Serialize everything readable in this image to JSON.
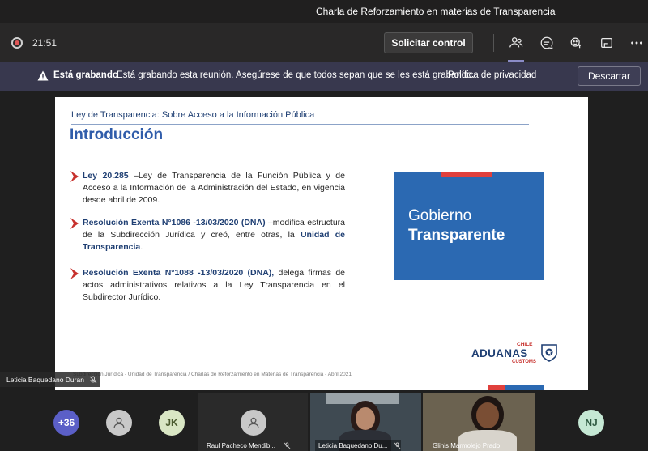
{
  "window": {
    "title": "Charla de Reforzamiento en materias de Transparencia"
  },
  "toolbar": {
    "timer": "21:51",
    "control_button": "Solicitar control",
    "icons": [
      "people-icon",
      "chat-icon",
      "reactions-icon",
      "share-tray-icon",
      "more-icon"
    ]
  },
  "banner": {
    "label": "Está grabando",
    "message": "Está grabando esta reunión. Asegúrese de que todos sepan que se les está grabando.",
    "policy_link": "Política de privacidad",
    "dismiss_button": "Descartar"
  },
  "slide": {
    "header": "Ley de Transparencia: Sobre Acceso a la Información Pública",
    "title": "Introducción",
    "bullets": [
      {
        "bold": "Ley 20.285",
        "text": " –Ley de Transparencia de la Función Pública y de Acceso a la Información de la Administración del Estado, en vigencia desde abril de 2009."
      },
      {
        "bold": "Resolución Exenta N°1086 -13/03/2020 (DNA)",
        "text": " –modifica estructura de la Subdirección Jurídica y creó, entre otras, la ",
        "bold2": "Unidad de Transparencia",
        "tail": "."
      },
      {
        "bold": "Resolución Exenta N°1088 -13/03/2020 (DNA),",
        "text": " delega firmas de actos administrativos relativos a la Ley Transparencia en el Subdirector Jurídico."
      }
    ],
    "logo_line1": "Gobierno",
    "logo_line2": "Transparente",
    "aduanas_chile": "CHILE",
    "aduanas_name": "ADUANAS",
    "aduanas_customs": "CUSTOMS",
    "footer": "Subdirección Jurídica - Unidad de Transparencia / Charlas de Reforzamiento en Materias de Transparencia - Abril 2021"
  },
  "presenter_tag": "Leticia Baquedano Duran",
  "participants": {
    "overflow_count": "+36",
    "jk_initials": "JK",
    "tile1_name": "Raul Pacheco Mendib...",
    "tile2_name": "Leticia Baquedano Du...",
    "tile3_name": "Glinis Marmolejo Prado",
    "nj_initials": "NJ"
  },
  "colors": {
    "accent": "#8b8cc7",
    "banner": "#38384e",
    "slide_blue": "#2b69b2",
    "slide_red": "#e0403c"
  }
}
